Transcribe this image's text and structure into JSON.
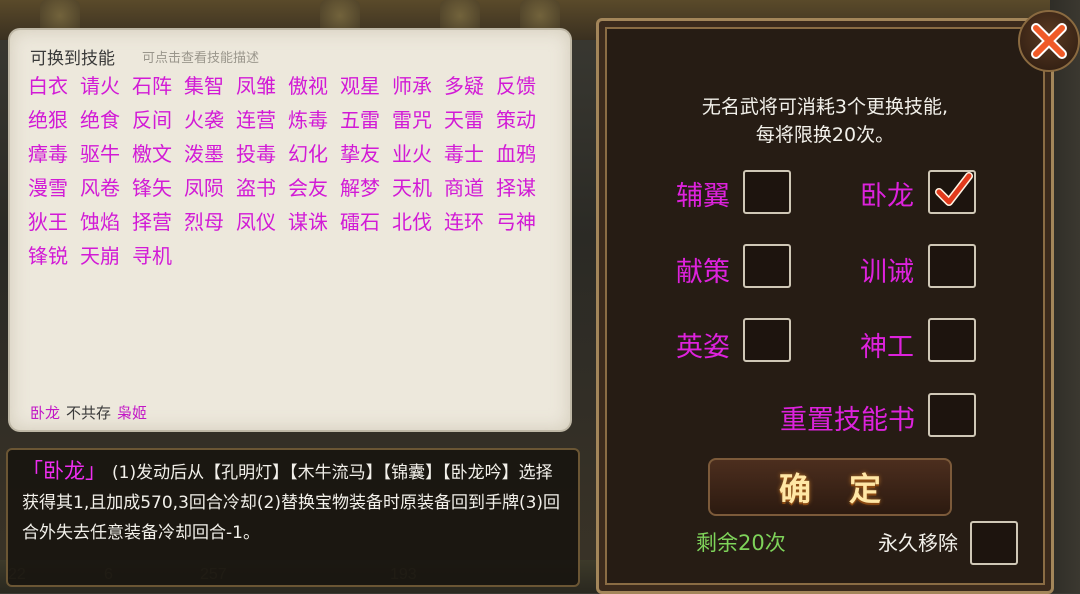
{
  "panel": {
    "title": "可换到技能",
    "hint": "可点击查看技能描述",
    "skills": [
      "白衣",
      "请火",
      "石阵",
      "集智",
      "凤雏",
      "傲视",
      "观星",
      "师承",
      "多疑",
      "反馈",
      "绝狠",
      "绝食",
      "反间",
      "火袭",
      "连营",
      "炼毒",
      "五雷",
      "雷咒",
      "天雷",
      "策动",
      "瘴毒",
      "驱牛",
      "檄文",
      "泼墨",
      "投毒",
      "幻化",
      "挚友",
      "业火",
      "毒士",
      "血鸦",
      "漫雪",
      "风卷",
      "锋矢",
      "凤陨",
      "盗书",
      "会友",
      "解梦",
      "天机",
      "商道",
      "择谋",
      "狄王",
      "蚀焰",
      "择营",
      "烈母",
      "凤仪",
      "谋诛",
      "礌石",
      "北伐",
      "连环",
      "弓神",
      "锋锐",
      "天崩",
      "寻机"
    ],
    "conflict": {
      "skill_a": "卧龙",
      "relation": "不共存",
      "skill_b": "枭姬"
    }
  },
  "description": {
    "name": "「卧龙」",
    "text": "(1)发动后从【孔明灯】【木牛流马】【锦囊】【卧龙吟】选择获得其1,且加成570,3回合冷却(2)替换宝物装备时原装备回到手牌(3)回合外失去任意装备冷却回合-1。"
  },
  "options": {
    "info_line1": "无名武将可消耗3个更换技能,",
    "info_line2": "每将限换20次。",
    "items": [
      {
        "label": "辅翼",
        "checked": false
      },
      {
        "label": "卧龙",
        "checked": true
      },
      {
        "label": "献策",
        "checked": false
      },
      {
        "label": "训诫",
        "checked": false
      },
      {
        "label": "英姿",
        "checked": false
      },
      {
        "label": "神工",
        "checked": false
      }
    ],
    "reset": {
      "label": "重置技能书",
      "checked": false
    },
    "confirm_label": "确定",
    "remaining": "剩余20次",
    "permanent_remove": {
      "label": "永久移除",
      "checked": false
    }
  },
  "background_numbers": [
    "22",
    "6",
    "257",
    "193"
  ],
  "colors": {
    "skill_text": "#d21ad6",
    "option_text": "#dd22dd",
    "remaining_text": "#7ed35a",
    "check_mark": "#e23a1c",
    "close_icon": "#f05a28"
  },
  "icons": {
    "close": "close-x-icon",
    "check": "check-icon"
  }
}
